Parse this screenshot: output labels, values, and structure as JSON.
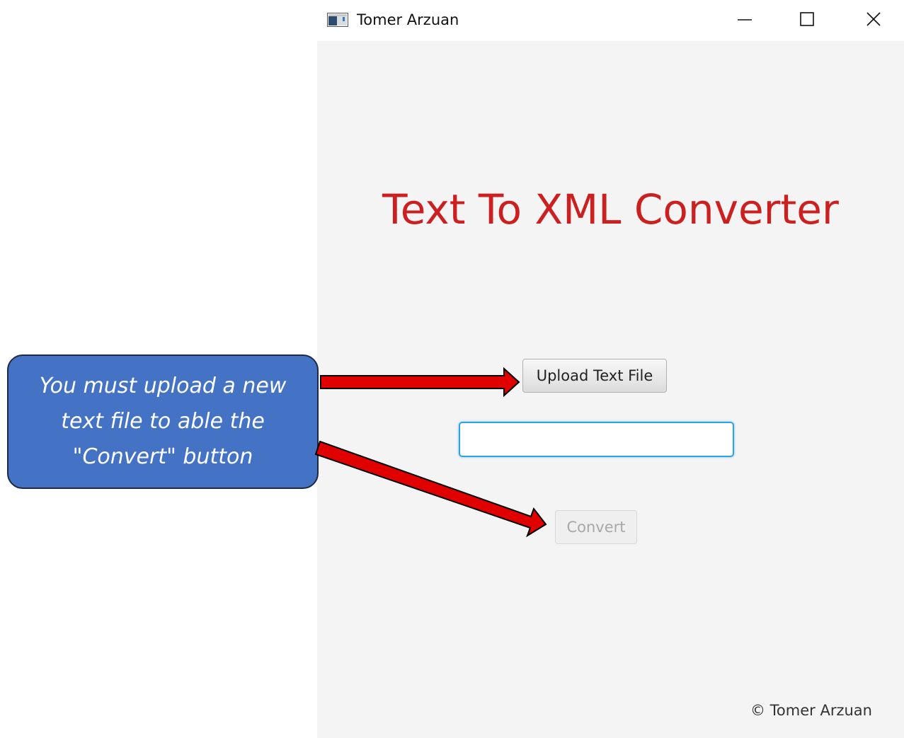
{
  "window": {
    "title": "Tomer Arzuan",
    "minimize_symbol": "—",
    "maximize_symbol": "☐",
    "close_symbol": "✕"
  },
  "main": {
    "heading": "Text To XML Converter",
    "upload_button_label": "Upload Text File",
    "file_path_value": "",
    "convert_button_label": "Convert",
    "convert_enabled": false,
    "copyright": "© Tomer Arzuan"
  },
  "annotation": {
    "callout_text": "You must upload a new\ntext  file to able the\n\"Convert\" button"
  },
  "colors": {
    "heading": "#cc1f1f",
    "callout_fill": "#4472c4",
    "arrow_fill": "#e00000",
    "field_focus": "#2fa3df"
  },
  "icons": {
    "app": "java-app-icon",
    "minimize": "minimize-icon",
    "maximize": "maximize-icon",
    "close": "close-icon"
  }
}
